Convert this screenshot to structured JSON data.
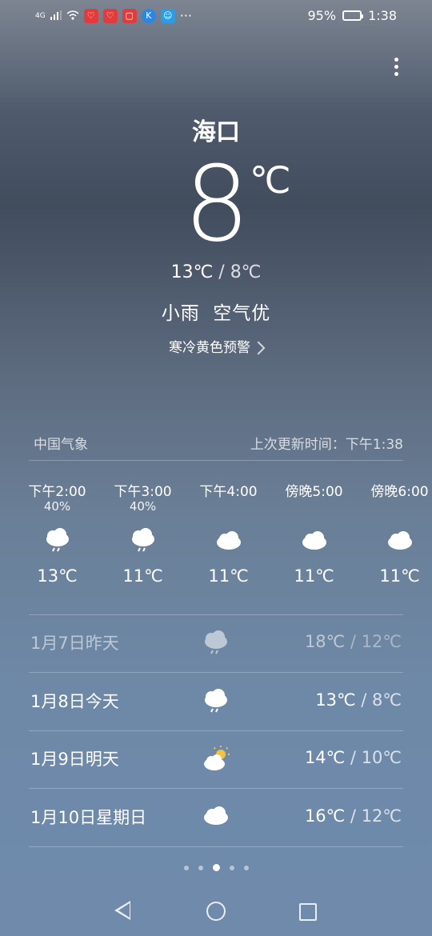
{
  "status_bar": {
    "network": "4G",
    "battery": "95%",
    "time": "1:38",
    "more": "···"
  },
  "city": "海口",
  "current": {
    "temp": "8",
    "unit": "℃",
    "high": "13℃",
    "sep": " / ",
    "low": "8℃",
    "condition": "小雨  空气优",
    "warning": "寒冷黄色预警"
  },
  "source": "中国气象",
  "updated": "上次更新时间：下午1:38",
  "hourly": [
    {
      "time": "下午2:00",
      "precip": "40%",
      "icon": "rain-cloud-icon",
      "temp": "13℃"
    },
    {
      "time": "下午3:00",
      "precip": "40%",
      "icon": "rain-cloud-icon",
      "temp": "11℃"
    },
    {
      "time": "下午4:00",
      "precip": "",
      "icon": "cloud-icon",
      "temp": "11℃"
    },
    {
      "time": "傍晚5:00",
      "precip": "",
      "icon": "cloud-icon",
      "temp": "11℃"
    },
    {
      "time": "傍晚6:00",
      "precip": "",
      "icon": "cloud-icon",
      "temp": "11℃"
    }
  ],
  "daily": [
    {
      "date": "1月7日昨天",
      "icon": "rain-cloud-icon",
      "high": "18℃",
      "sep": " / ",
      "low": "12℃"
    },
    {
      "date": "1月8日今天",
      "icon": "rain-cloud-icon",
      "high": "13℃",
      "sep": " / ",
      "low": "8℃"
    },
    {
      "date": "1月9日明天",
      "icon": "partly-sunny-icon",
      "high": "14℃",
      "sep": " / ",
      "low": "10℃"
    },
    {
      "date": "1月10日星期日",
      "icon": "cloud-icon",
      "high": "16℃",
      "sep": " / ",
      "low": "12℃"
    }
  ],
  "colors": {
    "sun": "#f5c23a",
    "cloud": "#ffffff"
  }
}
